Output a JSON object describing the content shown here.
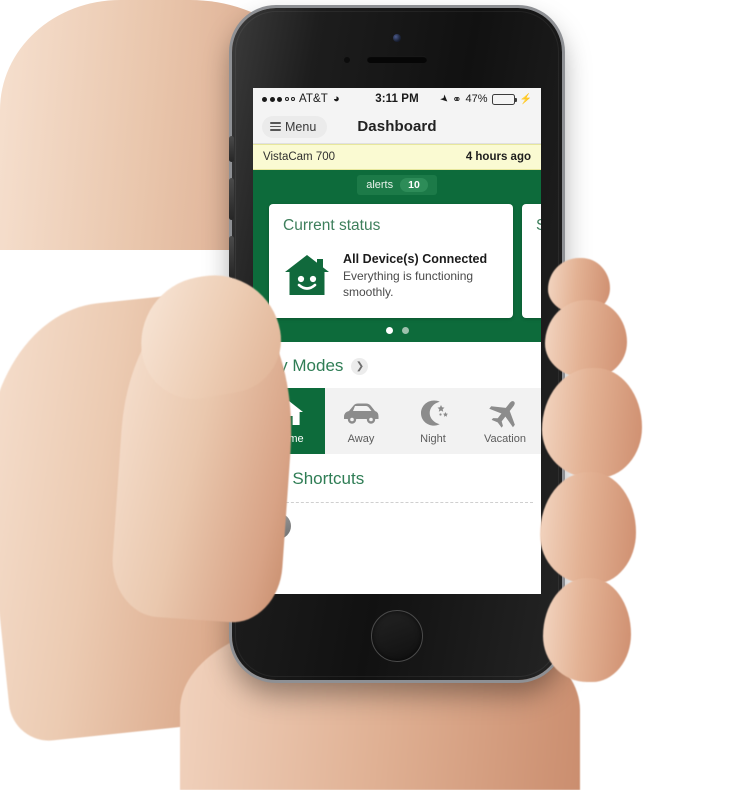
{
  "status_bar": {
    "signal_filled": 3,
    "signal_empty": 2,
    "carrier": "AT&T",
    "wifi_icon": "wifi-icon",
    "time": "3:11 PM",
    "location_icon": "location-arrow-icon",
    "bluetooth_icon": "bluetooth-icon",
    "battery_percent": "47%",
    "battery_level": 47,
    "charging_icon": "lightning-bolt-icon"
  },
  "nav": {
    "menu_icon": "hamburger-menu-icon",
    "menu_label": "Menu",
    "title": "Dashboard"
  },
  "alert_strip": {
    "device": "VistaCam 700",
    "time_ago": "4 hours ago"
  },
  "carousel": {
    "alerts_label": "alerts",
    "alerts_count": "10",
    "cards": [
      {
        "title": "Current status",
        "icon": "smiling-house-icon",
        "heading": "All Device(s) Connected",
        "subtext": "Everything is functioning smoothly."
      },
      {
        "title": "S",
        "icon": "",
        "heading": "",
        "subtext": ""
      }
    ],
    "page_dots": 2,
    "active_dot": 0
  },
  "modes": {
    "title": "My Modes",
    "chevron_icon": "chevron-right-icon",
    "items": [
      {
        "label": "Home",
        "icon": "house-icon",
        "active": true
      },
      {
        "label": "Away",
        "icon": "car-icon",
        "active": false
      },
      {
        "label": "Night",
        "icon": "moon-stars-icon",
        "active": false
      },
      {
        "label": "Vacation",
        "icon": "airplane-icon",
        "active": false
      }
    ]
  },
  "shortcuts": {
    "title": "My Shortcuts"
  },
  "colors": {
    "brand_green": "#0d6b3b",
    "title_green": "#2f7d55",
    "alert_strip_bg": "#fafad2",
    "battery_green": "#3ec63e"
  },
  "device": {
    "body_color": "#161616",
    "home_button": "home-button"
  }
}
